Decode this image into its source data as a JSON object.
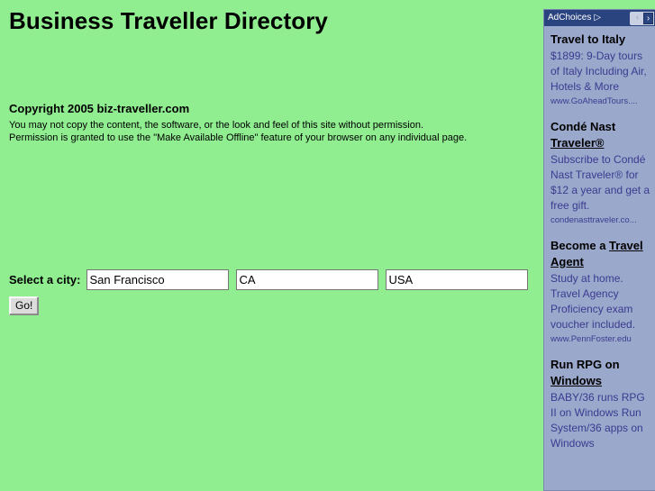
{
  "page": {
    "title": "Business Traveller Directory",
    "background_color": "#90ee90"
  },
  "copyright": {
    "heading": "Copyright 2005 biz-traveller.com",
    "line1": "You may not copy the content, the software, or the look and feel of this site without permission.",
    "line2": "Permission is granted to use the \"Make Available Offline\" feature of your browser on any individual page."
  },
  "form": {
    "label": "Select a city:",
    "city_value": "San Francisco",
    "city_placeholder": "",
    "state_value": "CA",
    "state_placeholder": "",
    "country_value": "USA",
    "country_placeholder": "",
    "submit_label": "Go!"
  },
  "ads": {
    "header": {
      "label": "AdChoices",
      "triangle_icon": "▷",
      "prev_arrow": "‹",
      "next_arrow": "›",
      "bar_color": "#2a4480"
    },
    "panel_color": "#9aa8cc",
    "link_color": "#3b3b8f",
    "items": [
      {
        "title_plain": "Travel to Italy",
        "title_link": "",
        "desc": "$1899: 9-Day tours of Italy Including Air, Hotels & More",
        "url": "www.GoAheadTours...."
      },
      {
        "title_plain": "Condé Nast ",
        "title_link": "Traveler®",
        "desc": "Subscribe to Condé Nast Traveler® for $12 a year and get a free gift.",
        "url": "condenasttraveler.co..."
      },
      {
        "title_plain": "Become a ",
        "title_link": "Travel Agent",
        "desc": "Study at home. Travel Agency Proficiency exam voucher included.",
        "url": "www.PennFoster.edu"
      },
      {
        "title_plain": "Run RPG on ",
        "title_link": "Windows",
        "desc": "BABY/36 runs RPG II on Windows Run System/36 apps on Windows",
        "url": ""
      }
    ]
  }
}
